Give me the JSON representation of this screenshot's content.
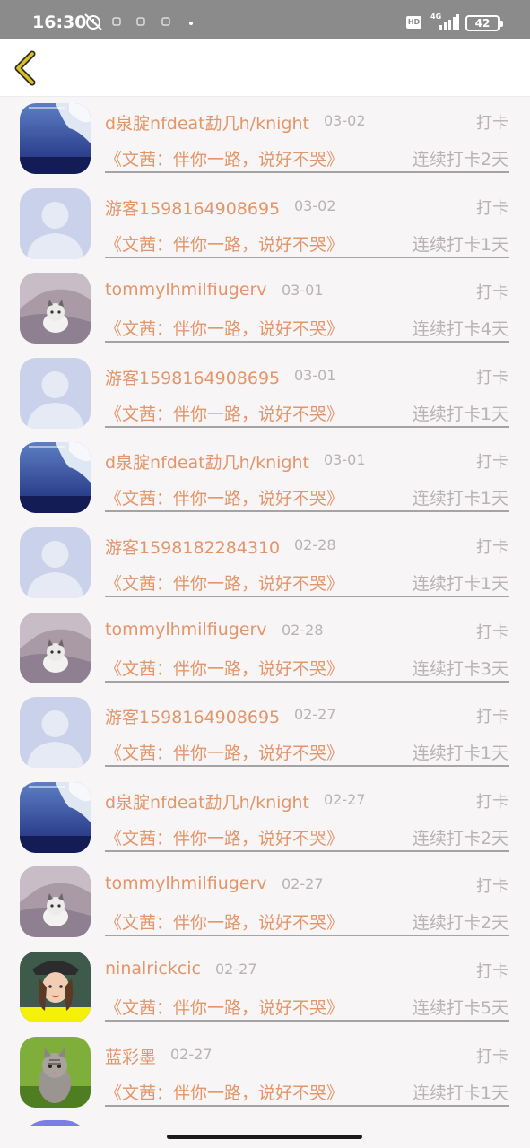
{
  "status_bar": {
    "time": "16:30",
    "network": "4G",
    "hd_label": "HD",
    "battery": "42"
  },
  "header": {
    "back_icon": "chevron-left-icon",
    "accent_color": "#d9c21f"
  },
  "rows": [
    {
      "name": "d泉腚nfdeat勐几h/knight",
      "date": "03-02",
      "action": "打卡",
      "book": "《文茜：伴你一路，说好不哭》",
      "streak": "连续打卡2天",
      "avatar": "sky-photo"
    },
    {
      "name": "游客1598164908695",
      "date": "03-02",
      "action": "打卡",
      "book": "《文茜：伴你一路，说好不哭》",
      "streak": "连续打卡1天",
      "avatar": "default-silhouette"
    },
    {
      "name": "tommylhmilfiugerv",
      "date": "03-01",
      "action": "打卡",
      "book": "《文茜：伴你一路，说好不哭》",
      "streak": "连续打卡4天",
      "avatar": "kitten-photo"
    },
    {
      "name": "游客1598164908695",
      "date": "03-01",
      "action": "打卡",
      "book": "《文茜：伴你一路，说好不哭》",
      "streak": "连续打卡1天",
      "avatar": "default-silhouette"
    },
    {
      "name": "d泉腚nfdeat勐几h/knight",
      "date": "03-01",
      "action": "打卡",
      "book": "《文茜：伴你一路，说好不哭》",
      "streak": "连续打卡1天",
      "avatar": "sky-photo"
    },
    {
      "name": "游客1598182284310",
      "date": "02-28",
      "action": "打卡",
      "book": "《文茜：伴你一路，说好不哭》",
      "streak": "连续打卡1天",
      "avatar": "default-silhouette"
    },
    {
      "name": "tommylhmilfiugerv",
      "date": "02-28",
      "action": "打卡",
      "book": "《文茜：伴你一路，说好不哭》",
      "streak": "连续打卡3天",
      "avatar": "kitten-photo"
    },
    {
      "name": "游客1598164908695",
      "date": "02-27",
      "action": "打卡",
      "book": "《文茜：伴你一路，说好不哭》",
      "streak": "连续打卡1天",
      "avatar": "default-silhouette"
    },
    {
      "name": "d泉腚nfdeat勐几h/knight",
      "date": "02-27",
      "action": "打卡",
      "book": "《文茜：伴你一路，说好不哭》",
      "streak": "连续打卡2天",
      "avatar": "sky-photo"
    },
    {
      "name": "tommylhmilfiugerv",
      "date": "02-27",
      "action": "打卡",
      "book": "《文茜：伴你一路，说好不哭》",
      "streak": "连续打卡2天",
      "avatar": "kitten-photo"
    },
    {
      "name": "ninalrickcic",
      "date": "02-27",
      "action": "打卡",
      "book": "《文茜：伴你一路，说好不哭》",
      "streak": "连续打卡5天",
      "avatar": "girl-photo"
    },
    {
      "name": "蓝彩墨",
      "date": "02-27",
      "action": "打卡",
      "book": "《文茜：伴你一路，说好不哭》",
      "streak": "连续打卡1天",
      "avatar": "tabby-cat-photo"
    }
  ]
}
